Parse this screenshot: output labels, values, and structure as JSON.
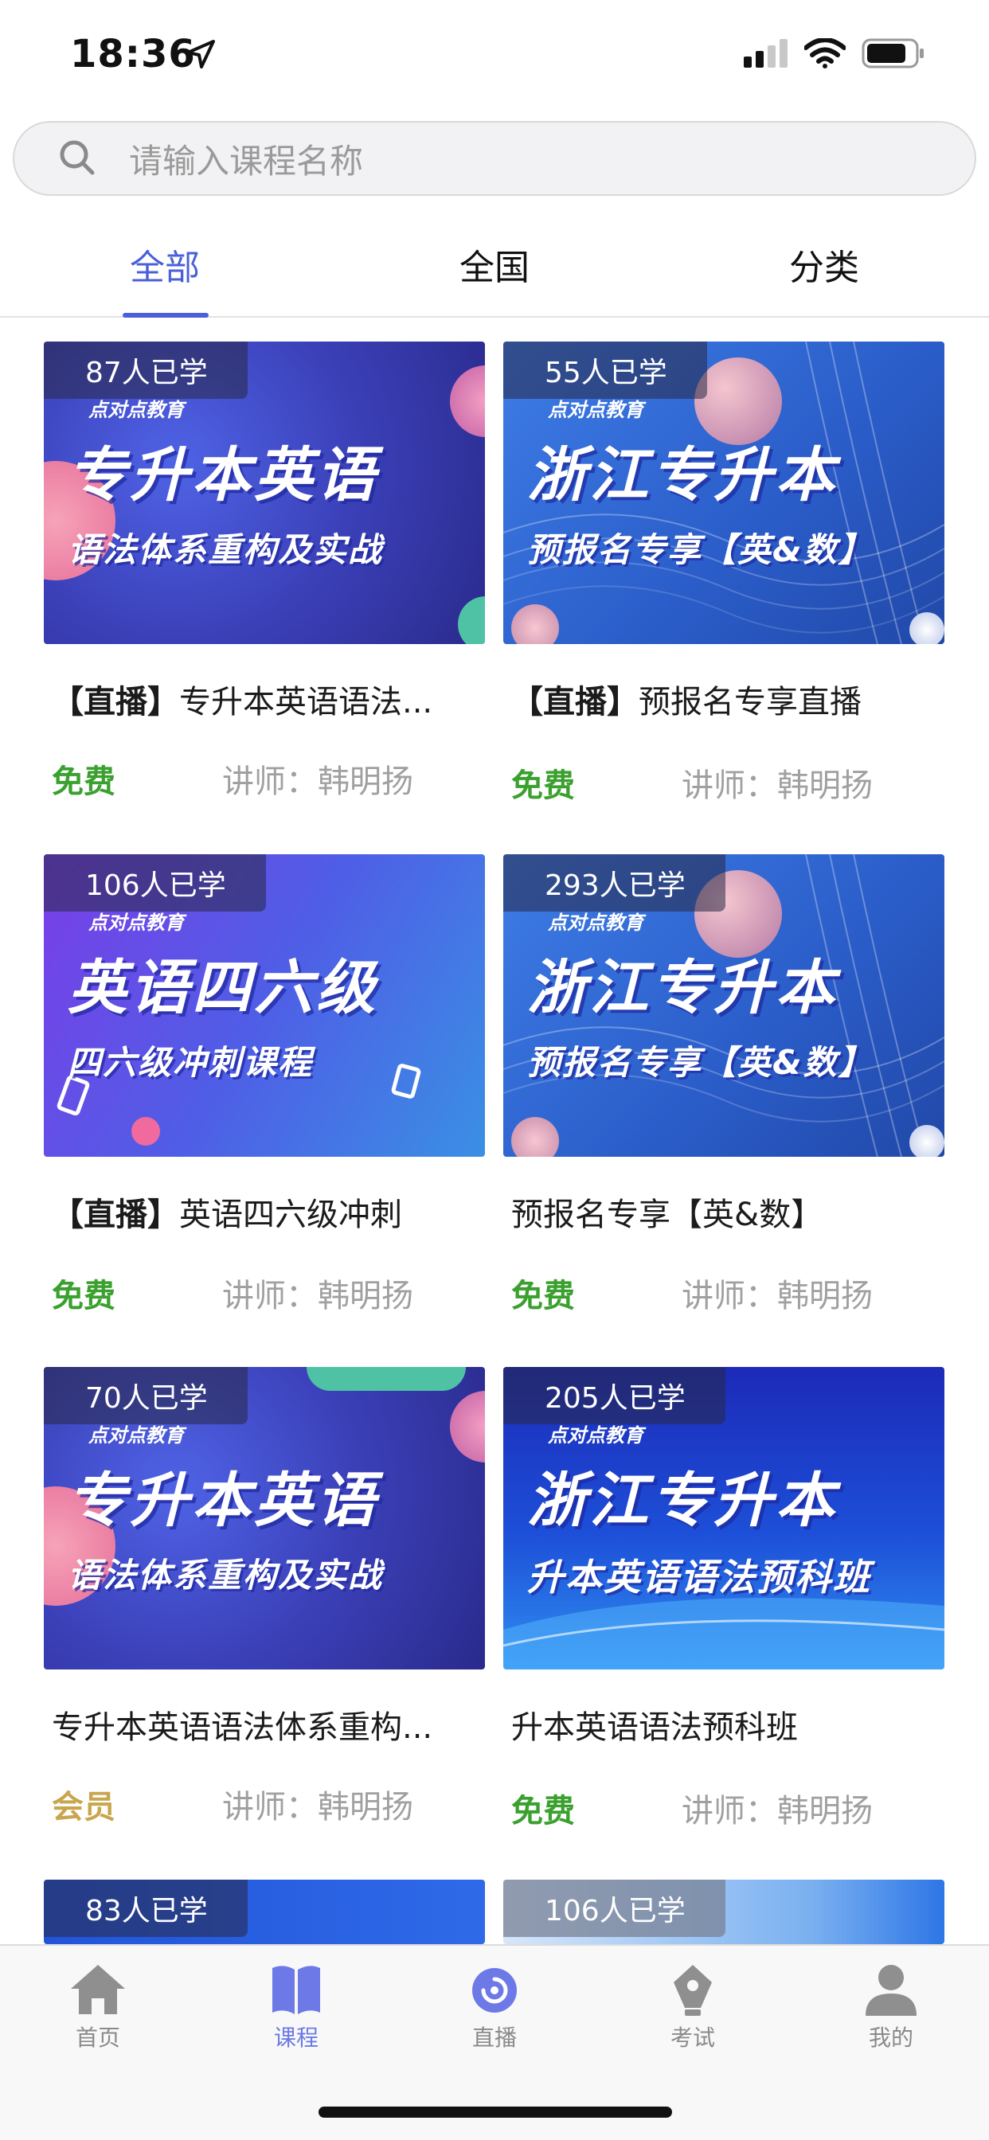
{
  "status_bar": {
    "time": "18:36"
  },
  "search": {
    "placeholder": "请输入课程名称"
  },
  "tabs": [
    {
      "label": "全部",
      "active": true
    },
    {
      "label": "全国",
      "active": false
    },
    {
      "label": "分类",
      "active": false
    }
  ],
  "courses": [
    {
      "learners": "87人已学",
      "brand": "点对点教育",
      "cover_title": "专升本英语",
      "cover_subtitle": "语法体系重构及实战",
      "tag": "【直播】",
      "name": "专升本英语语法...",
      "price": "免费",
      "teacher": "讲师：韩明扬"
    },
    {
      "learners": "55人已学",
      "brand": "点对点教育",
      "cover_title": "浙江专升本",
      "cover_subtitle": "预报名专享【英&数】",
      "tag": "【直播】",
      "name": "预报名专享直播",
      "price": "免费",
      "teacher": "讲师：韩明扬"
    },
    {
      "learners": "106人已学",
      "brand": "点对点教育",
      "cover_title": "英语四六级",
      "cover_subtitle": "四六级冲刺课程",
      "tag": "【直播】",
      "name": "英语四六级冲刺",
      "price": "免费",
      "teacher": "讲师：韩明扬"
    },
    {
      "learners": "293人已学",
      "brand": "点对点教育",
      "cover_title": "浙江专升本",
      "cover_subtitle": "预报名专享【英&数】",
      "tag": "",
      "name": "预报名专享【英&数】",
      "price": "免费",
      "teacher": "讲师：韩明扬"
    },
    {
      "learners": "70人已学",
      "brand": "点对点教育",
      "cover_title": "专升本英语",
      "cover_subtitle": "语法体系重构及实战",
      "tag": "",
      "name": "专升本英语语法体系重构...",
      "price": "会员",
      "teacher": "讲师：韩明扬"
    },
    {
      "learners": "205人已学",
      "brand": "点对点教育",
      "cover_title": "浙江专升本",
      "cover_subtitle": "升本英语语法预科班",
      "tag": "",
      "name": "升本英语语法预科班",
      "price": "免费",
      "teacher": "讲师：韩明扬"
    },
    {
      "learners": "83人已学"
    },
    {
      "learners": "106人已学"
    }
  ],
  "tabbar": [
    {
      "label": "首页",
      "icon": "home-icon",
      "active": false
    },
    {
      "label": "课程",
      "icon": "book-icon",
      "active": true
    },
    {
      "label": "直播",
      "icon": "live-icon",
      "active": false
    },
    {
      "label": "考试",
      "icon": "exam-icon",
      "active": false
    },
    {
      "label": "我的",
      "icon": "user-icon",
      "active": false
    }
  ],
  "colors": {
    "accent": "#4a5fd9",
    "free": "#3aa02e",
    "vip": "#c9a54d",
    "muted": "#a0a0a0"
  }
}
